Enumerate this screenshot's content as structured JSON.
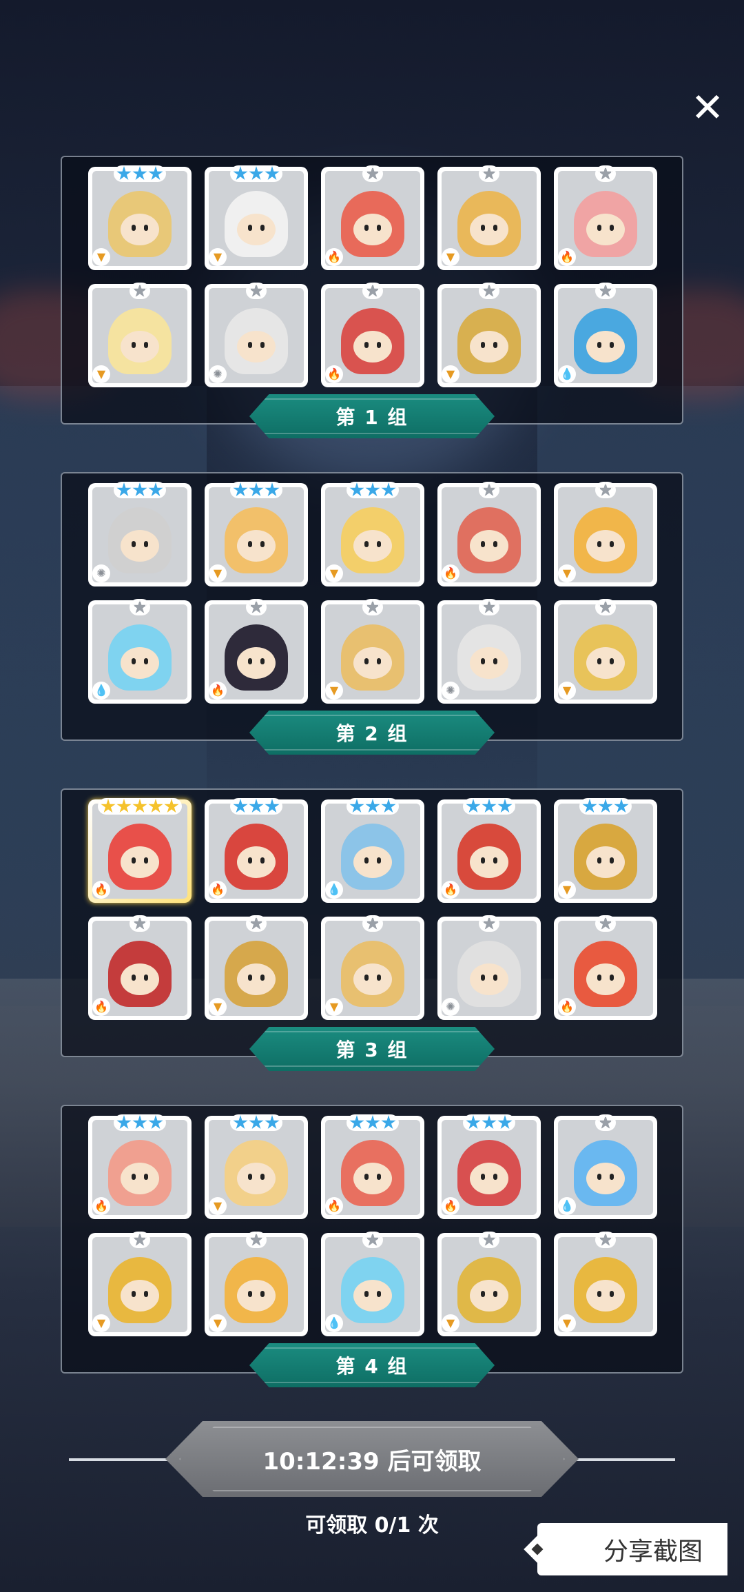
{
  "close_label": "✕",
  "groups": [
    {
      "label": "第 1 组",
      "cards": [
        {
          "stars": 3,
          "star_color": "blue",
          "element": "earth",
          "body": "#e8c878",
          "name": "hooded-hero"
        },
        {
          "stars": 3,
          "star_color": "blue",
          "element": "earth",
          "body": "#f0f0f0",
          "name": "dog-knight"
        },
        {
          "stars": 1,
          "star_color": "grey",
          "element": "fire",
          "body": "#e86a5a",
          "name": "bandaged-pumpkin"
        },
        {
          "stars": 1,
          "star_color": "grey",
          "element": "earth",
          "body": "#e9b85a",
          "name": "bandaged-pumpkin-gold"
        },
        {
          "stars": 1,
          "star_color": "grey",
          "element": "fire",
          "body": "#f0a4a4",
          "name": "pink-ghost"
        },
        {
          "stars": 1,
          "star_color": "grey",
          "element": "earth",
          "body": "#f5e3a0",
          "name": "yellow-ghost"
        },
        {
          "stars": 1,
          "star_color": "grey",
          "element": "light",
          "body": "#e6e6e6",
          "name": "white-ghost"
        },
        {
          "stars": 1,
          "star_color": "grey",
          "element": "fire",
          "body": "#d9534f",
          "name": "goggle-boy"
        },
        {
          "stars": 1,
          "star_color": "grey",
          "element": "earth",
          "body": "#d8b050",
          "name": "knight-boy"
        },
        {
          "stars": 1,
          "star_color": "grey",
          "element": "water",
          "body": "#4aa8e0",
          "name": "blue-spirit"
        }
      ]
    },
    {
      "label": "第 2 组",
      "cards": [
        {
          "stars": 3,
          "star_color": "blue",
          "element": "light",
          "body": "#d0d0d0",
          "name": "unicorn-knight"
        },
        {
          "stars": 3,
          "star_color": "blue",
          "element": "earth",
          "body": "#f2c06a",
          "name": "monk-hero"
        },
        {
          "stars": 3,
          "star_color": "blue",
          "element": "earth",
          "body": "#f3cf6a",
          "name": "queen"
        },
        {
          "stars": 1,
          "star_color": "grey",
          "element": "fire",
          "body": "#e07060",
          "name": "skull-mask"
        },
        {
          "stars": 1,
          "star_color": "grey",
          "element": "earth",
          "body": "#f1b64a",
          "name": "fox-guard"
        },
        {
          "stars": 1,
          "star_color": "grey",
          "element": "water",
          "body": "#7fd3f0",
          "name": "cat-girl-blue"
        },
        {
          "stars": 1,
          "star_color": "grey",
          "element": "fire",
          "body": "#2e2a3a",
          "name": "black-hair-girl"
        },
        {
          "stars": 1,
          "star_color": "grey",
          "element": "earth",
          "body": "#e8c070",
          "name": "moai-gold"
        },
        {
          "stars": 1,
          "star_color": "grey",
          "element": "light",
          "body": "#e4e4e4",
          "name": "moai-white"
        },
        {
          "stars": 1,
          "star_color": "grey",
          "element": "earth",
          "body": "#e8c35a",
          "name": "sun-spirit"
        }
      ]
    },
    {
      "label": "第 3 组",
      "cards": [
        {
          "stars": 5,
          "star_color": "gold",
          "element": "fire",
          "body": "#e8504a",
          "name": "red-cat-girl",
          "gold": true
        },
        {
          "stars": 3,
          "star_color": "blue",
          "element": "fire",
          "body": "#d9463e",
          "name": "red-dragon"
        },
        {
          "stars": 3,
          "star_color": "blue",
          "element": "water",
          "body": "#8cc4e8",
          "name": "old-sage-blue"
        },
        {
          "stars": 3,
          "star_color": "blue",
          "element": "fire",
          "body": "#d84a3c",
          "name": "clock-monster"
        },
        {
          "stars": 3,
          "star_color": "blue",
          "element": "earth",
          "body": "#d8a840",
          "name": "stone-golem"
        },
        {
          "stars": 1,
          "star_color": "grey",
          "element": "fire",
          "body": "#c43c3c",
          "name": "witch-girl"
        },
        {
          "stars": 1,
          "star_color": "grey",
          "element": "earth",
          "body": "#d6a84c",
          "name": "knight-boy-2"
        },
        {
          "stars": 1,
          "star_color": "grey",
          "element": "earth",
          "body": "#e8c070",
          "name": "moai-gold-2"
        },
        {
          "stars": 1,
          "star_color": "grey",
          "element": "light",
          "body": "#e0e0e0",
          "name": "winged-knight"
        },
        {
          "stars": 1,
          "star_color": "grey",
          "element": "fire",
          "body": "#e85a40",
          "name": "robot-bird"
        }
      ]
    },
    {
      "label": "第 4 组",
      "cards": [
        {
          "stars": 3,
          "star_color": "blue",
          "element": "fire",
          "body": "#f0a090",
          "name": "old-sage-red"
        },
        {
          "stars": 3,
          "star_color": "blue",
          "element": "earth",
          "body": "#f2d08a",
          "name": "old-sage-gold"
        },
        {
          "stars": 3,
          "star_color": "blue",
          "element": "fire",
          "body": "#e87060",
          "name": "red-queen"
        },
        {
          "stars": 3,
          "star_color": "blue",
          "element": "fire",
          "body": "#d85050",
          "name": "red-golem"
        },
        {
          "stars": 1,
          "star_color": "grey",
          "element": "water",
          "body": "#6ab8f0",
          "name": "cactus"
        },
        {
          "stars": 1,
          "star_color": "grey",
          "element": "earth",
          "body": "#e8b840",
          "name": "dino-hood"
        },
        {
          "stars": 1,
          "star_color": "grey",
          "element": "earth",
          "body": "#f1b64a",
          "name": "fox-guard-2"
        },
        {
          "stars": 1,
          "star_color": "grey",
          "element": "water",
          "body": "#7fd3f0",
          "name": "cat-girl-blue-2"
        },
        {
          "stars": 1,
          "star_color": "grey",
          "element": "earth",
          "body": "#e0b848",
          "name": "totem"
        },
        {
          "stars": 1,
          "star_color": "grey",
          "element": "earth",
          "body": "#e8b840",
          "name": "bandaged-lion"
        }
      ]
    }
  ],
  "claim": {
    "button_label": "10:12:39 后可领取",
    "count_label": "可领取 0/1 次"
  },
  "share_label": "分享截图"
}
